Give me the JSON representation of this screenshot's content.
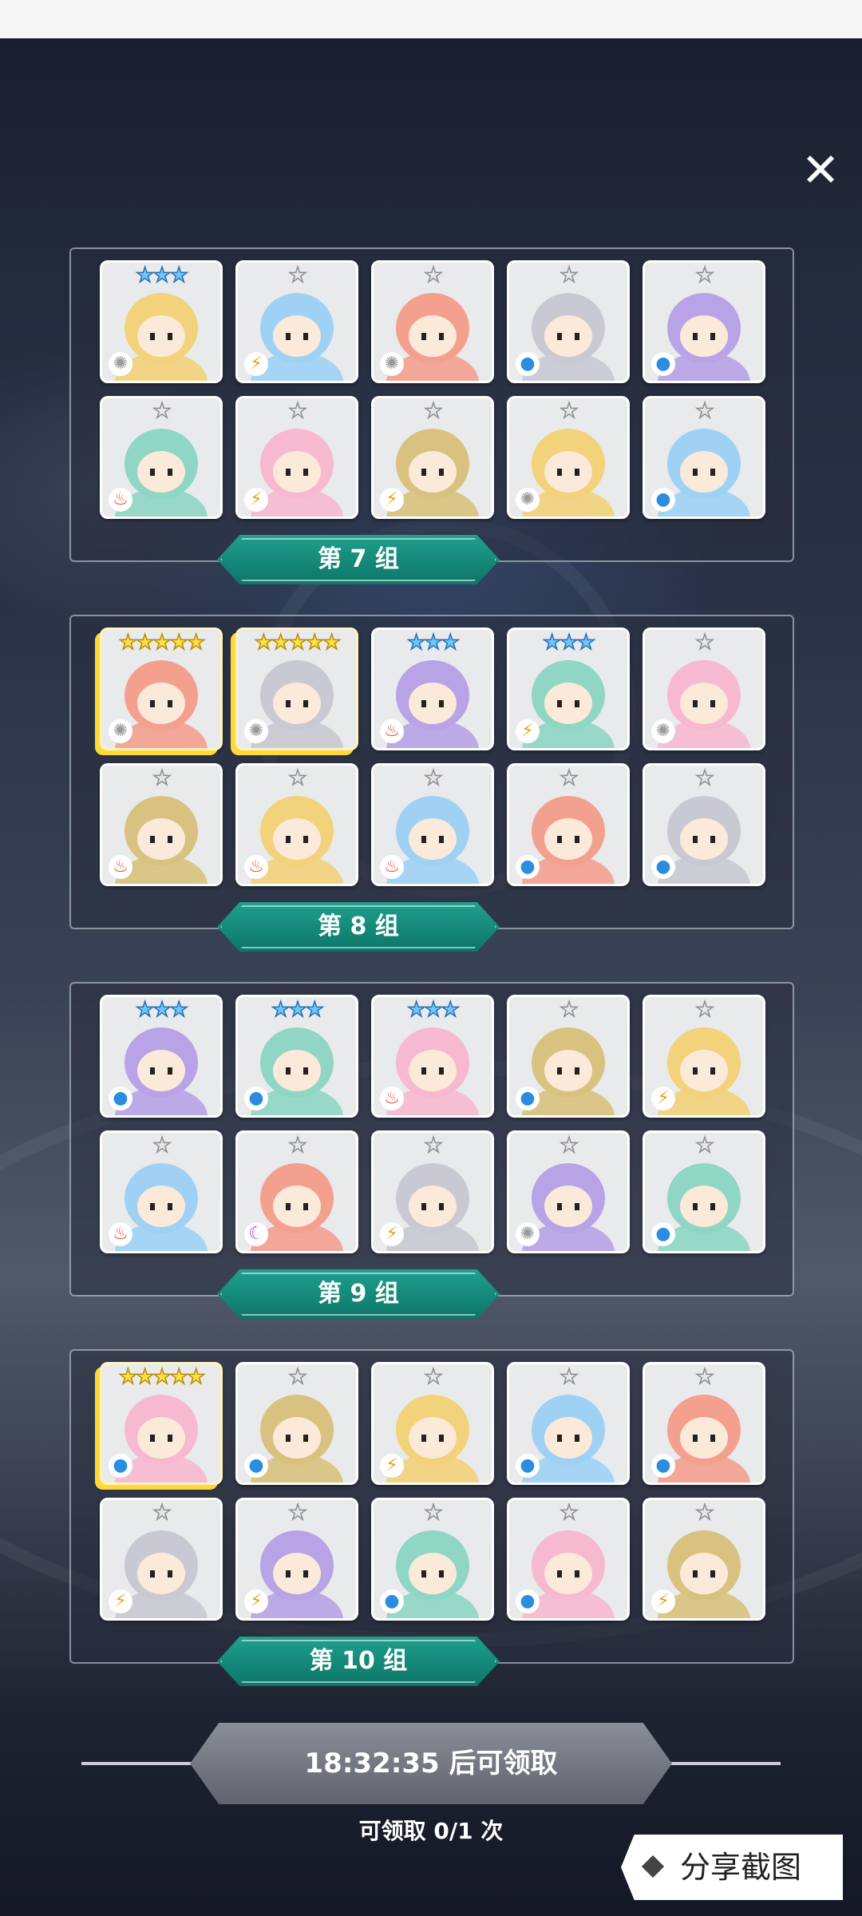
{
  "close_label": "✕",
  "groups": [
    {
      "label": "第 7 组",
      "cards": [
        {
          "stars": 3,
          "elem": "light",
          "name": "white-robot"
        },
        {
          "stars": 1,
          "elem": "thunder",
          "name": "bandaged-yellow"
        },
        {
          "stars": 1,
          "elem": "light",
          "name": "silver-hair-girl"
        },
        {
          "stars": 1,
          "elem": "water",
          "name": "goggles-boy"
        },
        {
          "stars": 1,
          "elem": "water",
          "name": "black-hair-girl"
        },
        {
          "stars": 1,
          "elem": "fire",
          "name": "pink-moai"
        },
        {
          "stars": 1,
          "elem": "thunder",
          "name": "winged-knight"
        },
        {
          "stars": 1,
          "elem": "thunder",
          "name": "winged-knight"
        },
        {
          "stars": 1,
          "elem": "light",
          "name": "chef-hat-man"
        },
        {
          "stars": 1,
          "elem": "water",
          "name": "blue-box-beast"
        }
      ]
    },
    {
      "label": "第 8 组",
      "cards": [
        {
          "stars": 5,
          "elem": "light",
          "name": "white-hair-sage",
          "gold": true
        },
        {
          "stars": 5,
          "elem": "light",
          "name": "white-unicorn",
          "gold": true
        },
        {
          "stars": 3,
          "elem": "fire",
          "name": "witch-hat-girl"
        },
        {
          "stars": 3,
          "elem": "thunder",
          "name": "eye-pyramid"
        },
        {
          "stars": 1,
          "elem": "light",
          "name": "tree-stump"
        },
        {
          "stars": 1,
          "elem": "fire",
          "name": "red-bear"
        },
        {
          "stars": 1,
          "elem": "fire",
          "name": "red-dragon"
        },
        {
          "stars": 1,
          "elem": "fire",
          "name": "red-dragon"
        },
        {
          "stars": 1,
          "elem": "water",
          "name": "ice-princess"
        },
        {
          "stars": 1,
          "elem": "water",
          "name": "ice-knight"
        }
      ]
    },
    {
      "label": "第 9 组",
      "cards": [
        {
          "stars": 3,
          "elem": "water",
          "name": "horned-warrior"
        },
        {
          "stars": 3,
          "elem": "water",
          "name": "blue-fish-man"
        },
        {
          "stars": 3,
          "elem": "fire",
          "name": "red-hooded"
        },
        {
          "stars": 1,
          "elem": "water",
          "name": "blue-cat-monster"
        },
        {
          "stars": 1,
          "elem": "thunder",
          "name": "yellow-skull"
        },
        {
          "stars": 1,
          "elem": "fire",
          "name": "red-hair-warrior"
        },
        {
          "stars": 1,
          "elem": "dark",
          "name": "purple-moai"
        },
        {
          "stars": 1,
          "elem": "thunder",
          "name": "curly-blonde"
        },
        {
          "stars": 1,
          "elem": "light",
          "name": "stone-totem"
        },
        {
          "stars": 1,
          "elem": "water",
          "name": "blue-robot"
        }
      ]
    },
    {
      "label": "第 10 组",
      "cards": [
        {
          "stars": 5,
          "elem": "water",
          "name": "white-yeti",
          "gold": true
        },
        {
          "stars": 1,
          "elem": "water",
          "name": "bandaged-blue"
        },
        {
          "stars": 1,
          "elem": "thunder",
          "name": "sunflower-monster"
        },
        {
          "stars": 1,
          "elem": "water",
          "name": "blue-ghost"
        },
        {
          "stars": 1,
          "elem": "water",
          "name": "blue-bear"
        },
        {
          "stars": 1,
          "elem": "thunder",
          "name": "blonde-fighter"
        },
        {
          "stars": 1,
          "elem": "thunder",
          "name": "dark-hair-girl"
        },
        {
          "stars": 1,
          "elem": "water",
          "name": "blue-oni"
        },
        {
          "stars": 1,
          "elem": "water",
          "name": "blue-totem"
        },
        {
          "stars": 1,
          "elem": "thunder",
          "name": "gold-chest"
        }
      ]
    }
  ],
  "timer_label": "18:32:35 后可领取",
  "claim_count": "可领取 0/1 次",
  "share_label": "分享截图",
  "colors": {
    "banner_teal": "#14907f",
    "fire": "#e84a2c",
    "water": "#2a8de0",
    "thunder": "#e6a415",
    "light": "#9a9a9a",
    "dark": "#b43bd6"
  }
}
